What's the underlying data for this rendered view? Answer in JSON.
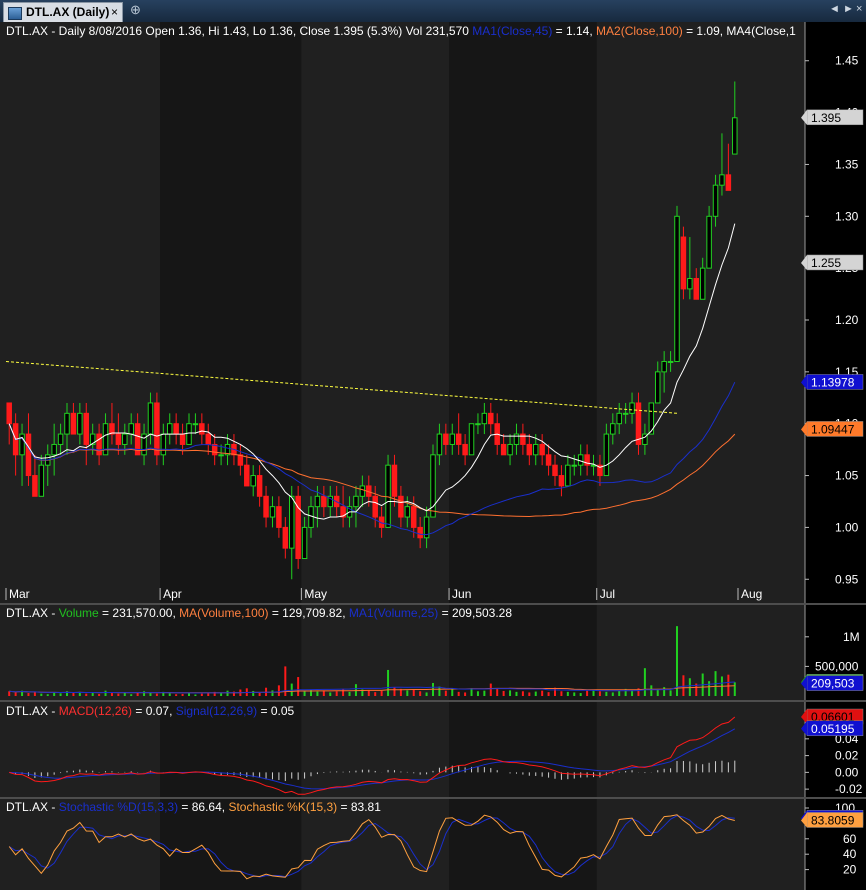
{
  "window": {
    "tab_title": "DTL.AX (Daily)",
    "close_glyph": "×",
    "pin_glyph": "⊕",
    "nav_left": "◄",
    "nav_right": "►",
    "nav_close": "×"
  },
  "price_panel": {
    "header": [
      {
        "text": "DTL.AX - Daily 8/08/2016 Open 1.36, Hi 1.43, Lo 1.36, Close 1.395 (5.3%) Vol 231,570 ",
        "color": "#ffffff"
      },
      {
        "text": "MA1(Close,45)",
        "color": "#1a2fcc"
      },
      {
        "text": " = 1.14, ",
        "color": "#ffffff"
      },
      {
        "text": "MA2(Close,100)",
        "color": "#ff8040"
      },
      {
        "text": " = 1.09, MA4(Close,1",
        "color": "#ffffff"
      }
    ],
    "y_ticks": [
      "1.45",
      "1.40",
      "1.35",
      "1.30",
      "1.25",
      "1.20",
      "1.15",
      "1.10",
      "1.05",
      "1.00",
      "0.95"
    ],
    "x_ticks": [
      "Mar",
      "Apr",
      "May",
      "Jun",
      "Jul",
      "Aug"
    ],
    "value_tags": [
      {
        "text": "1.395",
        "value": 1.395,
        "bg": "#d4d4d4",
        "fg": "#000000"
      },
      {
        "text": "1.255",
        "value": 1.255,
        "bg": "#d4d4d4",
        "fg": "#000000"
      },
      {
        "text": "1.13978",
        "value": 1.13978,
        "bg": "#1010d0",
        "fg": "#ffffff"
      },
      {
        "text": "1.09447",
        "value": 1.09447,
        "bg": "#ff7a2a",
        "fg": "#000000"
      }
    ]
  },
  "volume_panel": {
    "header": [
      {
        "text": "DTL.AX - ",
        "color": "#ffffff"
      },
      {
        "text": "Volume",
        "color": "#20c020"
      },
      {
        "text": " = 231,570.00, ",
        "color": "#ffffff"
      },
      {
        "text": "MA(Volume,100)",
        "color": "#ff8040"
      },
      {
        "text": " = 129,709.82, ",
        "color": "#ffffff"
      },
      {
        "text": "MA1(Volume,25)",
        "color": "#1a2fcc"
      },
      {
        "text": " = 209,503.28",
        "color": "#ffffff"
      }
    ],
    "y_ticks": [
      "1M",
      "500,000"
    ],
    "value_tags": [
      {
        "text": "231,570",
        "value": 231570,
        "bg": "#20a020",
        "fg": "#ffffff"
      },
      {
        "text": "209,503",
        "value": 209503,
        "bg": "#1010d0",
        "fg": "#ffffff"
      }
    ]
  },
  "macd_panel": {
    "header": [
      {
        "text": "DTL.AX - ",
        "color": "#ffffff"
      },
      {
        "text": "MACD(12,26)",
        "color": "#ff3030"
      },
      {
        "text": " = 0.07, ",
        "color": "#ffffff"
      },
      {
        "text": "Signal(12,26,9)",
        "color": "#1a2fcc"
      },
      {
        "text": " = 0.05",
        "color": "#ffffff"
      }
    ],
    "y_ticks": [
      "0.06",
      "0.04",
      "0.02",
      "0.00",
      "-0.02"
    ],
    "value_tags": [
      {
        "text": "0.06601",
        "value": 0.066,
        "bg": "#e01010",
        "fg": "#000000"
      },
      {
        "text": "0.05195",
        "value": 0.052,
        "bg": "#1010d0",
        "fg": "#ffffff"
      }
    ]
  },
  "stoch_panel": {
    "header": [
      {
        "text": "DTL.AX - ",
        "color": "#ffffff"
      },
      {
        "text": "Stochastic %D(15,3,3)",
        "color": "#1a2fcc"
      },
      {
        "text": " = 86.64, ",
        "color": "#ffffff"
      },
      {
        "text": "Stochastic %K(15,3)",
        "color": "#ffa040"
      },
      {
        "text": " = 83.81",
        "color": "#ffffff"
      }
    ],
    "y_ticks": [
      "100",
      "60",
      "40",
      "20"
    ],
    "value_tags": [
      {
        "text": "86.636",
        "value": 86.64,
        "bg": "#1010d0",
        "fg": "#ffffff"
      },
      {
        "text": "83.8059",
        "value": 83.81,
        "bg": "#ffa040",
        "fg": "#000000"
      }
    ]
  },
  "colors": {
    "up": "#20d020",
    "down": "#ff1a1a",
    "ma_fast": "#ffffff",
    "ma1": "#1a2fcc",
    "ma2": "#ff7030",
    "trendline": "#ffff40",
    "stoch_k": "#ffa040",
    "stoch_d": "#1a2fcc"
  },
  "chart_data": [
    {
      "type": "candlestick",
      "ylim": [
        0.93,
        1.47
      ],
      "month_start_index": [
        0,
        24,
        46,
        69,
        92,
        114
      ],
      "ohlc": [
        [
          1.12,
          1.12,
          1.08,
          1.1
        ],
        [
          1.1,
          1.11,
          1.05,
          1.07
        ],
        [
          1.07,
          1.1,
          1.04,
          1.09
        ],
        [
          1.09,
          1.11,
          1.04,
          1.05
        ],
        [
          1.05,
          1.07,
          1.03,
          1.03
        ],
        [
          1.03,
          1.07,
          1.03,
          1.06
        ],
        [
          1.06,
          1.08,
          1.04,
          1.07
        ],
        [
          1.07,
          1.1,
          1.05,
          1.08
        ],
        [
          1.08,
          1.1,
          1.07,
          1.09
        ],
        [
          1.09,
          1.12,
          1.07,
          1.11
        ],
        [
          1.11,
          1.12,
          1.09,
          1.09
        ],
        [
          1.09,
          1.12,
          1.08,
          1.11
        ],
        [
          1.11,
          1.12,
          1.06,
          1.08
        ],
        [
          1.08,
          1.1,
          1.07,
          1.09
        ],
        [
          1.09,
          1.1,
          1.06,
          1.07
        ],
        [
          1.07,
          1.11,
          1.07,
          1.1
        ],
        [
          1.1,
          1.12,
          1.08,
          1.09
        ],
        [
          1.09,
          1.11,
          1.07,
          1.08
        ],
        [
          1.08,
          1.1,
          1.07,
          1.09
        ],
        [
          1.09,
          1.11,
          1.08,
          1.1
        ],
        [
          1.1,
          1.11,
          1.07,
          1.07
        ],
        [
          1.07,
          1.1,
          1.06,
          1.09
        ],
        [
          1.09,
          1.13,
          1.08,
          1.12
        ],
        [
          1.12,
          1.13,
          1.06,
          1.07
        ],
        [
          1.07,
          1.1,
          1.06,
          1.09
        ],
        [
          1.09,
          1.11,
          1.08,
          1.1
        ],
        [
          1.1,
          1.11,
          1.08,
          1.09
        ],
        [
          1.09,
          1.1,
          1.07,
          1.08
        ],
        [
          1.08,
          1.11,
          1.08,
          1.1
        ],
        [
          1.1,
          1.11,
          1.09,
          1.1
        ],
        [
          1.1,
          1.11,
          1.08,
          1.09
        ],
        [
          1.09,
          1.1,
          1.07,
          1.08
        ],
        [
          1.08,
          1.09,
          1.06,
          1.07
        ],
        [
          1.07,
          1.08,
          1.06,
          1.07
        ],
        [
          1.07,
          1.09,
          1.06,
          1.08
        ],
        [
          1.08,
          1.09,
          1.06,
          1.07
        ],
        [
          1.07,
          1.08,
          1.05,
          1.06
        ],
        [
          1.06,
          1.07,
          1.04,
          1.04
        ],
        [
          1.04,
          1.06,
          1.03,
          1.05
        ],
        [
          1.05,
          1.06,
          1.02,
          1.03
        ],
        [
          1.03,
          1.04,
          1.0,
          1.01
        ],
        [
          1.01,
          1.03,
          1.0,
          1.02
        ],
        [
          1.02,
          1.03,
          0.99,
          1.0
        ],
        [
          1.0,
          1.01,
          0.97,
          0.98
        ],
        [
          0.98,
          1.04,
          0.95,
          1.03
        ],
        [
          1.03,
          1.04,
          0.96,
          0.97
        ],
        [
          0.97,
          1.01,
          0.97,
          1.0
        ],
        [
          1.0,
          1.03,
          0.99,
          1.02
        ],
        [
          1.02,
          1.04,
          1.0,
          1.03
        ],
        [
          1.03,
          1.04,
          1.01,
          1.02
        ],
        [
          1.02,
          1.04,
          1.01,
          1.03
        ],
        [
          1.03,
          1.04,
          1.01,
          1.02
        ],
        [
          1.02,
          1.04,
          1.0,
          1.01
        ],
        [
          1.01,
          1.03,
          1.0,
          1.02
        ],
        [
          1.02,
          1.04,
          1.0,
          1.03
        ],
        [
          1.03,
          1.05,
          1.02,
          1.04
        ],
        [
          1.04,
          1.05,
          1.02,
          1.03
        ],
        [
          1.03,
          1.04,
          1.0,
          1.01
        ],
        [
          1.01,
          1.02,
          0.99,
          1.0
        ],
        [
          1.0,
          1.07,
          1.0,
          1.06
        ],
        [
          1.06,
          1.07,
          1.02,
          1.03
        ],
        [
          1.03,
          1.04,
          1.0,
          1.01
        ],
        [
          1.01,
          1.03,
          1.0,
          1.02
        ],
        [
          1.02,
          1.03,
          0.99,
          1.0
        ],
        [
          1.0,
          1.01,
          0.98,
          0.99
        ],
        [
          0.99,
          1.02,
          0.98,
          1.01
        ],
        [
          1.01,
          1.08,
          1.01,
          1.07
        ],
        [
          1.07,
          1.1,
          1.06,
          1.09
        ],
        [
          1.09,
          1.1,
          1.07,
          1.08
        ],
        [
          1.08,
          1.1,
          1.07,
          1.09
        ],
        [
          1.09,
          1.11,
          1.07,
          1.08
        ],
        [
          1.08,
          1.09,
          1.06,
          1.07
        ],
        [
          1.07,
          1.1,
          1.07,
          1.1
        ],
        [
          1.1,
          1.11,
          1.09,
          1.1
        ],
        [
          1.1,
          1.12,
          1.09,
          1.11
        ],
        [
          1.11,
          1.12,
          1.09,
          1.1
        ],
        [
          1.1,
          1.11,
          1.07,
          1.08
        ],
        [
          1.08,
          1.09,
          1.07,
          1.07
        ],
        [
          1.07,
          1.09,
          1.06,
          1.08
        ],
        [
          1.08,
          1.1,
          1.07,
          1.09
        ],
        [
          1.09,
          1.1,
          1.07,
          1.08
        ],
        [
          1.08,
          1.09,
          1.06,
          1.07
        ],
        [
          1.07,
          1.09,
          1.06,
          1.08
        ],
        [
          1.08,
          1.09,
          1.06,
          1.07
        ],
        [
          1.07,
          1.08,
          1.05,
          1.06
        ],
        [
          1.06,
          1.07,
          1.04,
          1.05
        ],
        [
          1.05,
          1.06,
          1.03,
          1.04
        ],
        [
          1.04,
          1.07,
          1.04,
          1.06
        ],
        [
          1.06,
          1.07,
          1.05,
          1.06
        ],
        [
          1.06,
          1.08,
          1.05,
          1.07
        ],
        [
          1.07,
          1.08,
          1.05,
          1.06
        ],
        [
          1.06,
          1.07,
          1.05,
          1.06
        ],
        [
          1.06,
          1.07,
          1.04,
          1.05
        ],
        [
          1.05,
          1.1,
          1.05,
          1.09
        ],
        [
          1.09,
          1.11,
          1.08,
          1.1
        ],
        [
          1.1,
          1.12,
          1.09,
          1.11
        ],
        [
          1.11,
          1.12,
          1.1,
          1.11
        ],
        [
          1.11,
          1.13,
          1.1,
          1.12
        ],
        [
          1.12,
          1.13,
          1.07,
          1.08
        ],
        [
          1.08,
          1.1,
          1.07,
          1.09
        ],
        [
          1.09,
          1.12,
          1.09,
          1.12
        ],
        [
          1.12,
          1.16,
          1.12,
          1.15
        ],
        [
          1.15,
          1.17,
          1.13,
          1.16
        ],
        [
          1.16,
          1.17,
          1.15,
          1.16
        ],
        [
          1.16,
          1.31,
          1.2,
          1.3
        ],
        [
          1.28,
          1.29,
          1.22,
          1.23
        ],
        [
          1.23,
          1.28,
          1.22,
          1.24
        ],
        [
          1.24,
          1.25,
          1.22,
          1.22
        ],
        [
          1.22,
          1.26,
          1.22,
          1.25
        ],
        [
          1.25,
          1.31,
          1.25,
          1.3
        ],
        [
          1.3,
          1.34,
          1.29,
          1.33
        ],
        [
          1.33,
          1.38,
          1.32,
          1.34
        ],
        [
          1.34,
          1.37,
          1.33,
          1.325
        ],
        [
          1.36,
          1.43,
          1.36,
          1.395
        ]
      ],
      "ma_fast": [],
      "ma1_last": 1.14,
      "ma2_last": 1.09,
      "trendline": {
        "from_index": 0,
        "from_value": 1.16,
        "to_index": 104,
        "to_value": 1.11
      }
    },
    {
      "type": "bar",
      "name": "Volume",
      "ylim": [
        0,
        1250000
      ],
      "values": [
        80000,
        60000,
        90000,
        50000,
        70000,
        40000,
        30000,
        60000,
        45000,
        80000,
        50000,
        70000,
        40000,
        60000,
        35000,
        90000,
        50000,
        40000,
        65000,
        30000,
        55000,
        80000,
        60000,
        40000,
        70000,
        45000,
        30000,
        35000,
        50000,
        25000,
        40000,
        60000,
        70000,
        55000,
        90000,
        75000,
        110000,
        130000,
        85000,
        60000,
        140000,
        95000,
        180000,
        500000,
        210000,
        320000,
        90000,
        110000,
        75000,
        95000,
        60000,
        80000,
        120000,
        70000,
        200000,
        110000,
        90000,
        65000,
        85000,
        440000,
        150000,
        120000,
        95000,
        110000,
        80000,
        60000,
        220000,
        160000,
        90000,
        110000,
        70000,
        60000,
        130000,
        80000,
        90000,
        210000,
        130000,
        85000,
        95000,
        70000,
        80000,
        60000,
        75000,
        90000,
        65000,
        140000,
        80000,
        70000,
        60000,
        50000,
        90000,
        110000,
        80000,
        70000,
        60000,
        90000,
        120000,
        100000,
        130000,
        470000,
        180000,
        120000,
        150000,
        95000,
        1180000,
        350000,
        300000,
        210000,
        380000,
        250000,
        420000,
        330000,
        360000,
        231570
      ]
    },
    {
      "type": "line",
      "name": "MACD",
      "ylim": [
        -0.027,
        0.072
      ],
      "last_values": {
        "macd": 0.066,
        "signal": 0.052
      }
    },
    {
      "type": "line",
      "name": "Stochastic",
      "ylim": [
        0,
        100
      ],
      "last_values": {
        "d": 86.64,
        "k": 83.81
      }
    }
  ]
}
